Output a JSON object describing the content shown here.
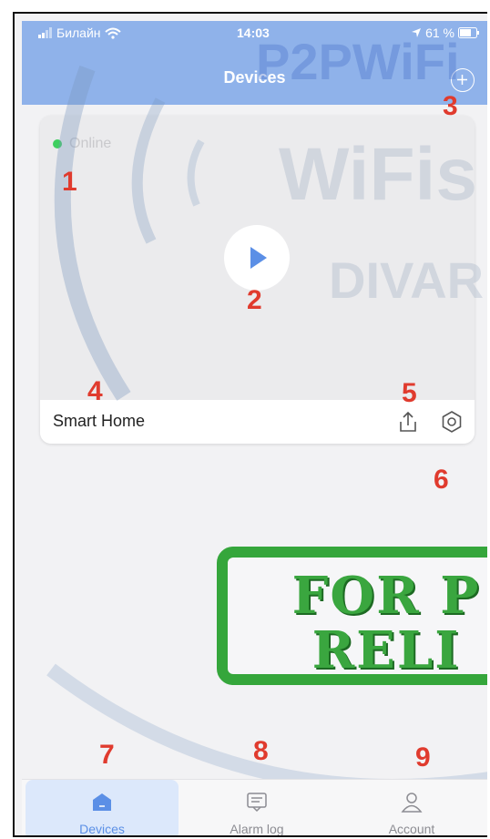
{
  "status_bar": {
    "carrier": "Билайн",
    "time": "14:03",
    "battery": "61 %"
  },
  "header": {
    "title": "Devices"
  },
  "device_card": {
    "status_text": "Online",
    "device_name": "Smart Home"
  },
  "annotations": {
    "n1": "1",
    "n2": "2",
    "n3": "3",
    "n4": "4",
    "n5": "5",
    "n6": "6",
    "n7": "7",
    "n8": "8",
    "n9": "9"
  },
  "watermark": {
    "brand_1": "P2PWiFi",
    "brand_2": "WiFis",
    "brand_3": "DIVAR",
    "stamp_line_1": "FOR P",
    "stamp_line_2": "RELI"
  },
  "tabs": [
    {
      "label": "Devices",
      "icon": "home-icon",
      "active": true
    },
    {
      "label": "Alarm log",
      "icon": "message-icon",
      "active": false
    },
    {
      "label": "Account",
      "icon": "user-icon",
      "active": false
    }
  ],
  "colors": {
    "accent": "#5b8fe6",
    "header": "#8fb2ea",
    "online": "#3fcf60",
    "annotation": "#e03b2e",
    "stamp": "#35a63b"
  }
}
